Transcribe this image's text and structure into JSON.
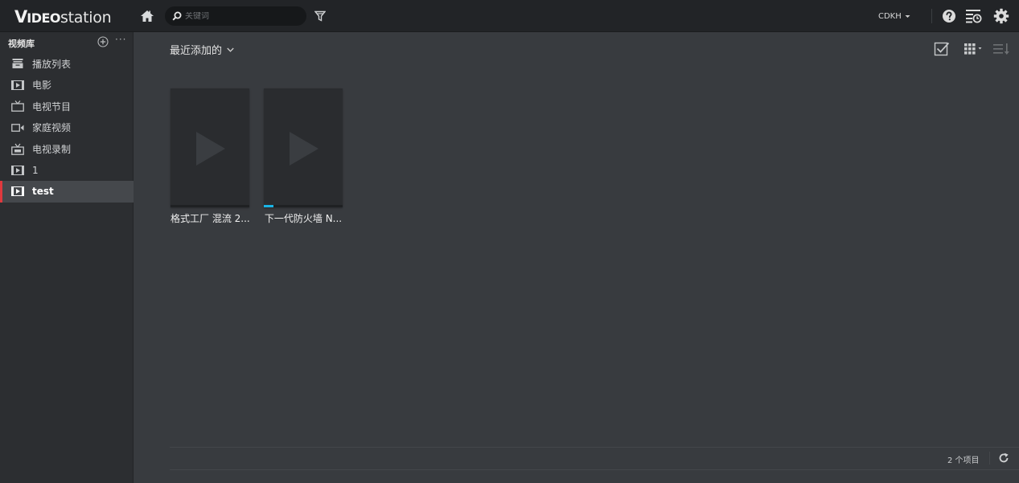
{
  "app": {
    "logo_v": "V",
    "logo_ideo": "IDEO",
    "logo_station": "station"
  },
  "topbar": {
    "search_placeholder": "关键词",
    "user": "CDKH"
  },
  "sidebar": {
    "title": "视频库",
    "more": "···",
    "items": [
      {
        "label": "播放列表",
        "icon": "playlist-icon"
      },
      {
        "label": "电影",
        "icon": "movie-icon"
      },
      {
        "label": "电视节目",
        "icon": "tv-show-icon"
      },
      {
        "label": "家庭视频",
        "icon": "home-video-icon"
      },
      {
        "label": "电视录制",
        "icon": "tv-recording-icon"
      },
      {
        "label": "1",
        "icon": "film-icon"
      },
      {
        "label": "test",
        "icon": "film-icon",
        "active": true
      }
    ]
  },
  "main": {
    "sort_label": "最近添加的",
    "videos": [
      {
        "title": "格式工厂 混流 2...",
        "progress": 0
      },
      {
        "title": "下一代防火墙 N...",
        "progress": 0.12
      }
    ],
    "item_count": "2 个项目"
  },
  "colors": {
    "accent_red": "#e0393e",
    "progress_blue": "#19b4e6"
  }
}
